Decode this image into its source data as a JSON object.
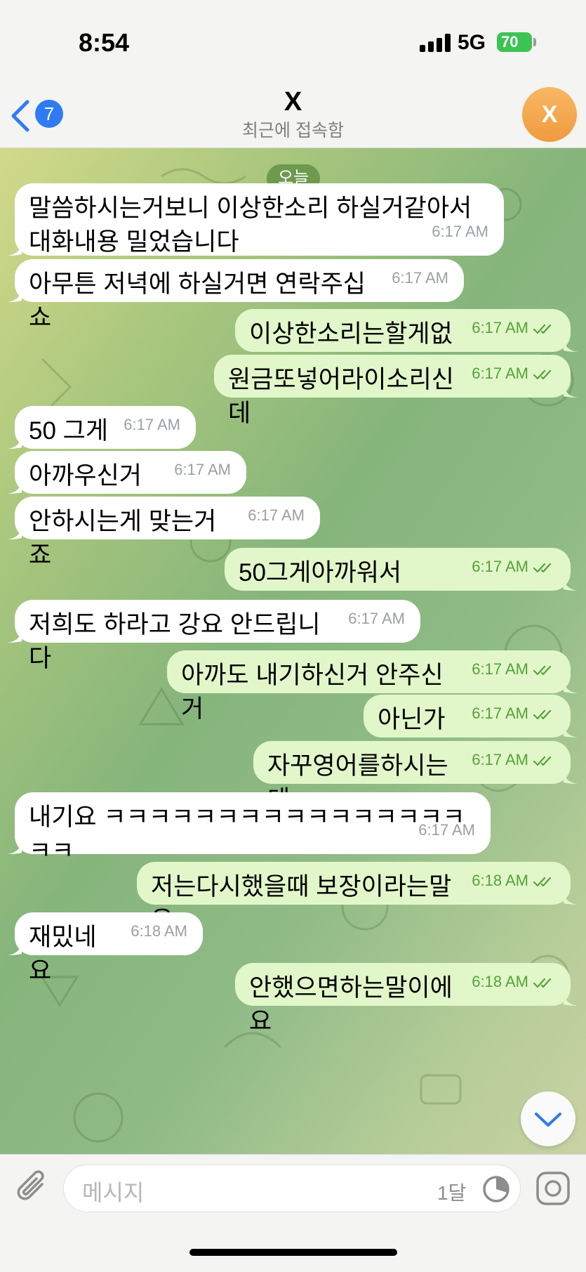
{
  "status_bar": {
    "time": "8:54",
    "network": "5G",
    "battery": "70"
  },
  "header": {
    "back_count": "7",
    "title": "X",
    "subtitle": "최근에 접속함",
    "avatar_letter": "X"
  },
  "chat": {
    "date_label": "오늘",
    "messages": [
      {
        "dir": "in",
        "text": "말씀하시는거보니 이상한소리 하실거같아서 대화내용 밀었습니다",
        "time": "6:17 AM"
      },
      {
        "dir": "in",
        "text": "아무튼 저녁에 하실거면 연락주십쇼",
        "time": "6:17 AM"
      },
      {
        "dir": "out",
        "text": "이상한소리는할게없구",
        "time": "6:17 AM",
        "read": true
      },
      {
        "dir": "out",
        "text": "원금또넣어라이소리신데",
        "time": "6:17 AM",
        "read": true
      },
      {
        "dir": "in",
        "text": "50 그게",
        "time": "6:17 AM"
      },
      {
        "dir": "in",
        "text": "아까우신거면",
        "time": "6:17 AM"
      },
      {
        "dir": "in",
        "text": "안하시는게 맞는거죠",
        "time": "6:17 AM"
      },
      {
        "dir": "out",
        "text": "50그게아까워서",
        "time": "6:17 AM",
        "read": true
      },
      {
        "dir": "in",
        "text": "저희도 하라고 강요 안드립니다",
        "time": "6:17 AM"
      },
      {
        "dir": "out",
        "text": "아까도 내기하신거 안주신거",
        "time": "6:17 AM",
        "read": true
      },
      {
        "dir": "out",
        "text": "아닌가욤",
        "time": "6:17 AM",
        "read": true
      },
      {
        "dir": "out",
        "text": "자꾸영어를하시는데",
        "time": "6:17 AM",
        "read": true
      },
      {
        "dir": "in",
        "text": "내기요 ㅋㅋㅋㅋㅋㅋㅋㅋㅋㅋㅋㅋㅋㅋㅋㅋㅋㅋ",
        "time": "6:17 AM"
      },
      {
        "dir": "out",
        "text": "저는다시했을때 보장이라는말은",
        "time": "6:18 AM",
        "read": true
      },
      {
        "dir": "in",
        "text": "재밌네요",
        "time": "6:18 AM"
      },
      {
        "dir": "out",
        "text": "안했으면하는말이에요",
        "time": "6:18 AM",
        "read": true
      }
    ]
  },
  "input": {
    "placeholder": "메시지",
    "timer_label": "1달"
  },
  "icons": {
    "back": "chevron-left-icon",
    "attach": "paperclip-icon",
    "timer": "timer-icon",
    "camera": "camera-icon",
    "scroll": "chevron-down-icon",
    "read": "double-check-icon"
  },
  "colors": {
    "accent": "#2f7bf3",
    "outgoing_bubble": "#e2f7c9",
    "outgoing_meta": "#54a23a",
    "avatar": "#f3a54c",
    "date_pill": "#6d9a4d"
  }
}
